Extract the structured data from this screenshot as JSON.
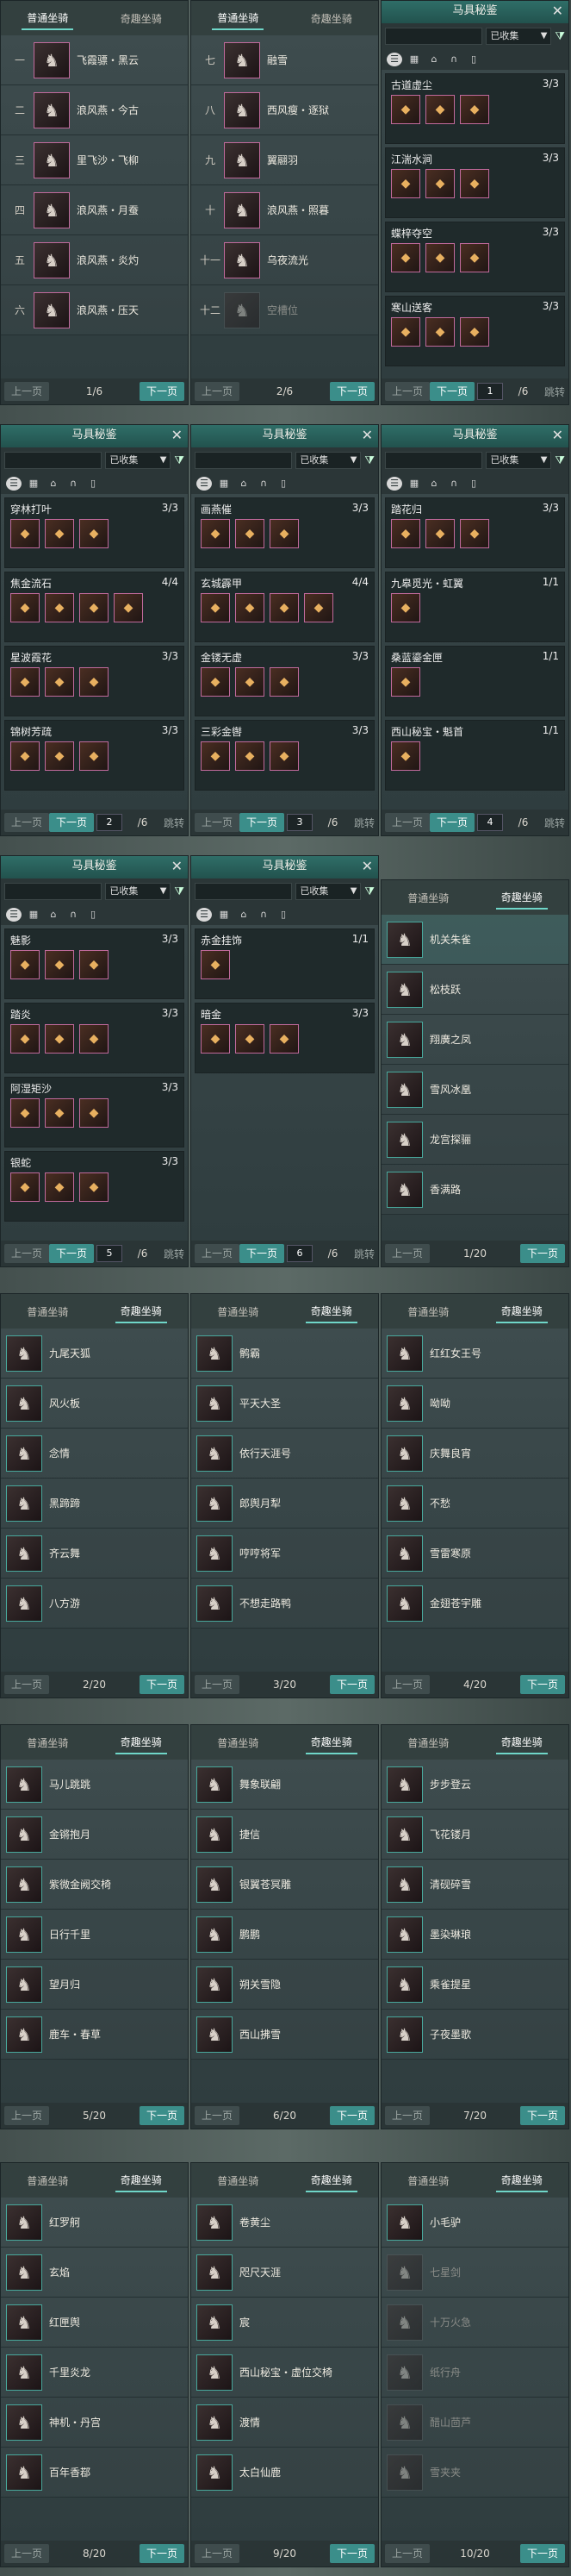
{
  "screens": {
    "p1": {
      "tabs": [
        "普通坐骑",
        "奇趣坐骑"
      ],
      "active": 0,
      "rows": [
        [
          "一",
          "飞霞骠・黑云"
        ],
        [
          "二",
          "浪风燕・今古"
        ],
        [
          "三",
          "里飞沙・飞柳"
        ],
        [
          "四",
          "浪风燕・月蚕"
        ],
        [
          "五",
          "浪风燕・炎灼"
        ],
        [
          "六",
          "浪风燕・压天"
        ]
      ],
      "prev": "上一页",
      "count": "1/6",
      "next": "下一页"
    },
    "p2": {
      "tabs": [
        "普通坐骑",
        "奇趣坐骑"
      ],
      "active": 0,
      "rows": [
        [
          "七",
          "融雪"
        ],
        [
          "八",
          "西风瘦・逐狱"
        ],
        [
          "九",
          "翼翮羽"
        ],
        [
          "十",
          "浪风燕・照暮"
        ],
        [
          "十一",
          "乌夜流光"
        ],
        [
          "十二",
          "空槽位"
        ]
      ],
      "prev": "上一页",
      "count": "2/6",
      "next": "下一页"
    },
    "p3": {
      "title": "马具秘鉴",
      "close": "✕",
      "filter": "已收集",
      "groups": [
        [
          "古道虚尘",
          "3/3",
          3
        ],
        [
          "江湍水涧",
          "3/3",
          3
        ],
        [
          "蝶梓夺空",
          "3/3",
          3
        ],
        [
          "寒山送客",
          "3/3",
          3
        ]
      ],
      "prev": "上一页",
      "next": "下一页",
      "page": "1",
      "total": "/6",
      "jump": "跳转"
    },
    "p4": {
      "title": "马具秘鉴",
      "close": "✕",
      "filter": "已收集",
      "groups": [
        [
          "穿林打叶",
          "3/3",
          3
        ],
        [
          "焦金流石",
          "4/4",
          4
        ],
        [
          "星波霞花",
          "3/3",
          3
        ],
        [
          "锦树芳疏",
          "3/3",
          3
        ]
      ],
      "prev": "上一页",
      "next": "下一页",
      "page": "2",
      "total": "/6",
      "jump": "跳转"
    },
    "p5": {
      "title": "马具秘鉴",
      "close": "✕",
      "filter": "已收集",
      "groups": [
        [
          "画燕催",
          "3/3",
          3
        ],
        [
          "玄城霹甲",
          "4/4",
          4
        ],
        [
          "金镂无虚",
          "3/3",
          3
        ],
        [
          "三彩金辔",
          "3/3",
          3
        ]
      ],
      "prev": "上一页",
      "next": "下一页",
      "page": "3",
      "total": "/6",
      "jump": "跳转"
    },
    "p6": {
      "title": "马具秘鉴",
      "close": "✕",
      "filter": "已收集",
      "groups": [
        [
          "踏花归",
          "3/3",
          3
        ],
        [
          "九皋觅光・虹翼",
          "1/1",
          1
        ],
        [
          "桑蓝鎏金匣",
          "1/1",
          1
        ],
        [
          "西山秘宝・魁首",
          "1/1",
          1
        ]
      ],
      "prev": "上一页",
      "next": "下一页",
      "page": "4",
      "total": "/6",
      "jump": "跳转"
    },
    "p7": {
      "title": "马具秘鉴",
      "close": "✕",
      "filter": "已收集",
      "groups": [
        [
          "魅影",
          "3/3",
          3
        ],
        [
          "踏炎",
          "3/3",
          3
        ],
        [
          "阿湿矩沙",
          "3/3",
          3
        ],
        [
          "银蛇",
          "3/3",
          3
        ]
      ],
      "prev": "上一页",
      "next": "下一页",
      "page": "5",
      "total": "/6",
      "jump": "跳转"
    },
    "p8": {
      "title": "马具秘鉴",
      "close": "✕",
      "filter": "已收集",
      "groups": [
        [
          "赤金挂饰",
          "1/1",
          1
        ],
        [
          "暗金",
          "3/3",
          3
        ]
      ],
      "prev": "上一页",
      "next": "下一页",
      "page": "6",
      "total": "/6",
      "jump": "跳转"
    },
    "p9": {
      "tabs": [
        "普通坐骑",
        "奇趣坐骑"
      ],
      "active": 1,
      "rows": [
        [
          "",
          "机关朱雀"
        ],
        [
          "",
          "松枝跃"
        ],
        [
          "",
          "翔廣之凤"
        ],
        [
          "",
          "雪风冰凰"
        ],
        [
          "",
          "龙宫探骊"
        ],
        [
          "",
          "香满路"
        ]
      ],
      "prev": "上一页",
      "count": "1/20",
      "next": "下一页"
    },
    "p10": {
      "tabs": [
        "普通坐骑",
        "奇趣坐骑"
      ],
      "active": 1,
      "rows": [
        [
          "",
          "九尾天狐"
        ],
        [
          "",
          "风火板"
        ],
        [
          "",
          "念情"
        ],
        [
          "",
          "黑蹄蹄"
        ],
        [
          "",
          "齐云舞"
        ],
        [
          "",
          "八方游"
        ]
      ],
      "prev": "上一页",
      "count": "2/20",
      "next": "下一页"
    },
    "p11": {
      "tabs": [
        "普通坐骑",
        "奇趣坐骑"
      ],
      "active": 1,
      "rows": [
        [
          "",
          "鹘霸"
        ],
        [
          "",
          "平天大圣"
        ],
        [
          "",
          "依行天涯号"
        ],
        [
          "",
          "郎舆月犁"
        ],
        [
          "",
          "哼哼将军"
        ],
        [
          "",
          "不想走路鸭"
        ]
      ],
      "prev": "上一页",
      "count": "3/20",
      "next": "下一页"
    },
    "p12": {
      "tabs": [
        "普通坐骑",
        "奇趣坐骑"
      ],
      "active": 1,
      "rows": [
        [
          "",
          "红红女王号"
        ],
        [
          "",
          "呦呦"
        ],
        [
          "",
          "庆舞良宵"
        ],
        [
          "",
          "不愁"
        ],
        [
          "",
          "雪雷寒原"
        ],
        [
          "",
          "金翅苍宇雕"
        ]
      ],
      "prev": "上一页",
      "count": "4/20",
      "next": "下一页"
    },
    "p13": {
      "tabs": [
        "普通坐骑",
        "奇趣坐骑"
      ],
      "active": 1,
      "rows": [
        [
          "",
          "马儿跳跳"
        ],
        [
          "",
          "金锵抱月"
        ],
        [
          "",
          "紫微金阙交椅"
        ],
        [
          "",
          "日行千里"
        ],
        [
          "",
          "望月归"
        ],
        [
          "",
          "鹿车・春草"
        ]
      ],
      "prev": "上一页",
      "count": "5/20",
      "next": "下一页"
    },
    "p14": {
      "tabs": [
        "普通坐骑",
        "奇趣坐骑"
      ],
      "active": 1,
      "rows": [
        [
          "",
          "舞象联翩"
        ],
        [
          "",
          "捷信"
        ],
        [
          "",
          "银翼苍冥雕"
        ],
        [
          "",
          "鹏鹏"
        ],
        [
          "",
          "朔关雪隐"
        ],
        [
          "",
          "西山拂雪"
        ]
      ],
      "prev": "上一页",
      "count": "6/20",
      "next": "下一页"
    },
    "p15": {
      "tabs": [
        "普通坐骑",
        "奇趣坐骑"
      ],
      "active": 1,
      "rows": [
        [
          "",
          "步步登云"
        ],
        [
          "",
          "飞花镂月"
        ],
        [
          "",
          "清砚碎雪"
        ],
        [
          "",
          "墨染琳琅"
        ],
        [
          "",
          "乘雀提星"
        ],
        [
          "",
          "子夜墨歌"
        ]
      ],
      "prev": "上一页",
      "count": "7/20",
      "next": "下一页"
    },
    "p16": {
      "tabs": [
        "普通坐骑",
        "奇趣坐骑"
      ],
      "active": 1,
      "rows": [
        [
          "",
          "红罗舸"
        ],
        [
          "",
          "玄焰"
        ],
        [
          "",
          "红匣舆"
        ],
        [
          "",
          "千里炎龙"
        ],
        [
          "",
          "神机・丹宫"
        ],
        [
          "",
          "百年香鄀"
        ]
      ],
      "prev": "上一页",
      "count": "8/20",
      "next": "下一页"
    },
    "p17": {
      "tabs": [
        "普通坐骑",
        "奇趣坐骑"
      ],
      "active": 1,
      "rows": [
        [
          "",
          "卷黄尘"
        ],
        [
          "",
          "咫尺天涯"
        ],
        [
          "",
          "宸"
        ],
        [
          "",
          "西山秘宝・虚位交椅"
        ],
        [
          "",
          "渡情"
        ],
        [
          "",
          "太白仙鹿"
        ]
      ],
      "prev": "上一页",
      "count": "9/20",
      "next": "下一页"
    },
    "p18": {
      "tabs": [
        "普通坐骑",
        "奇趣坐骑"
      ],
      "active": 1,
      "rows": [
        [
          "",
          "小毛驴"
        ],
        [
          "",
          "七星剑"
        ],
        [
          "",
          "十万火急"
        ],
        [
          "",
          "纸行舟"
        ],
        [
          "",
          "醋山茴芦"
        ],
        [
          "",
          "雪夹夹"
        ]
      ],
      "prev": "上一页",
      "count": "10/20",
      "next": "下一页"
    }
  },
  "glyphs": {
    "mount": "♞",
    "item": "◆",
    "icon_list": "☰",
    "icon_grid": "▦",
    "icon_saddle": "⌂",
    "icon_bridle": "∩",
    "icon_cloth": "▯",
    "funnel": "⧩",
    "dropdown": "▼"
  }
}
